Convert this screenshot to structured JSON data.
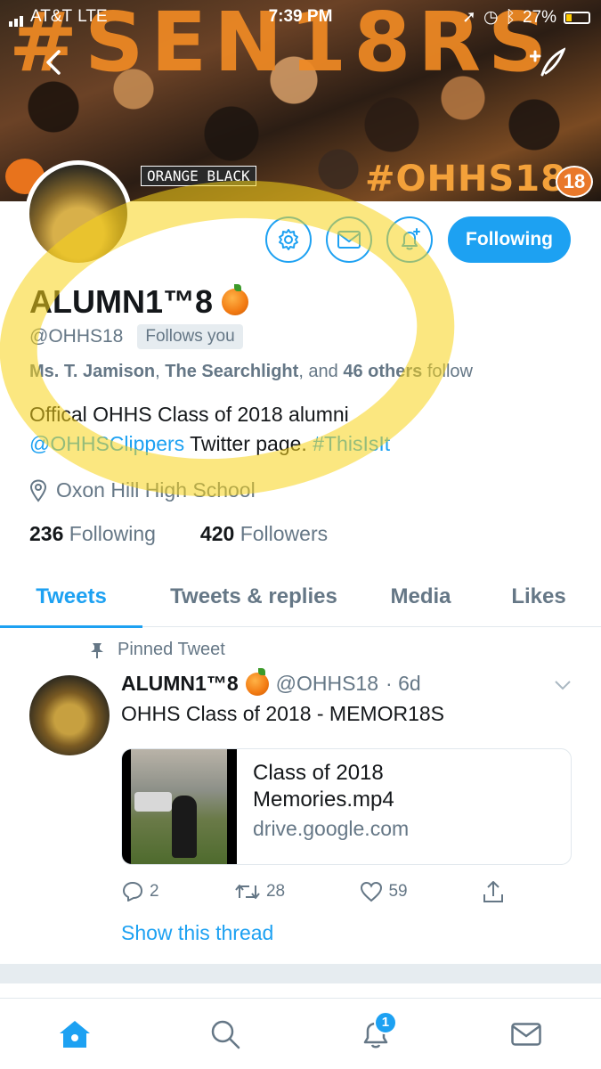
{
  "status_bar": {
    "carrier": "AT&T",
    "network": "LTE",
    "time": "7:39 PM",
    "battery": "27%",
    "battery_level": 0.27
  },
  "banner": {
    "title_text": "#SEN18RS",
    "hashtag": "#OHHS18",
    "sticker": "ORANGE BLACK",
    "badge": "18"
  },
  "profile": {
    "display_name": "ALUMN1™8",
    "handle": "@OHHS18",
    "follows_you": "Follows you",
    "following_button": "Following",
    "followers_you_know": {
      "name1": "Ms. T. Jamison",
      "sep1": ", ",
      "name2": "The Searchlight",
      "mid": ", and ",
      "others": "46 others",
      "suffix": " follow"
    },
    "bio": {
      "line1": "Offical OHHS Class of 2018 alumni",
      "mention": "@OHHSClippers",
      "middle": " Twitter page. ",
      "hashtag": "#ThisIsIt"
    },
    "location": "Oxon Hill High School",
    "following_count": "236",
    "following_label": "Following",
    "followers_count": "420",
    "followers_label": "Followers"
  },
  "tabs": [
    {
      "label": "Tweets",
      "active": true
    },
    {
      "label": "Tweets & replies",
      "active": false
    },
    {
      "label": "Media",
      "active": false
    },
    {
      "label": "Likes",
      "active": false
    }
  ],
  "pinned_tweet": {
    "pinned_label": "Pinned Tweet",
    "author_name": "ALUMN1™8",
    "author_handle": "@OHHS18",
    "age": "· 6d",
    "text": "OHHS Class of 2018 - MEMOR18S",
    "card": {
      "title": "Class of 2018 Memories.mp4",
      "domain": "drive.google.com"
    },
    "replies": "2",
    "retweets": "28",
    "likes": "59",
    "show_thread": "Show this thread"
  },
  "bottom_nav": {
    "notifications_badge": "1"
  },
  "colors": {
    "accent": "#1da1f2",
    "muted": "#657786",
    "highlight": "#f7d417"
  }
}
